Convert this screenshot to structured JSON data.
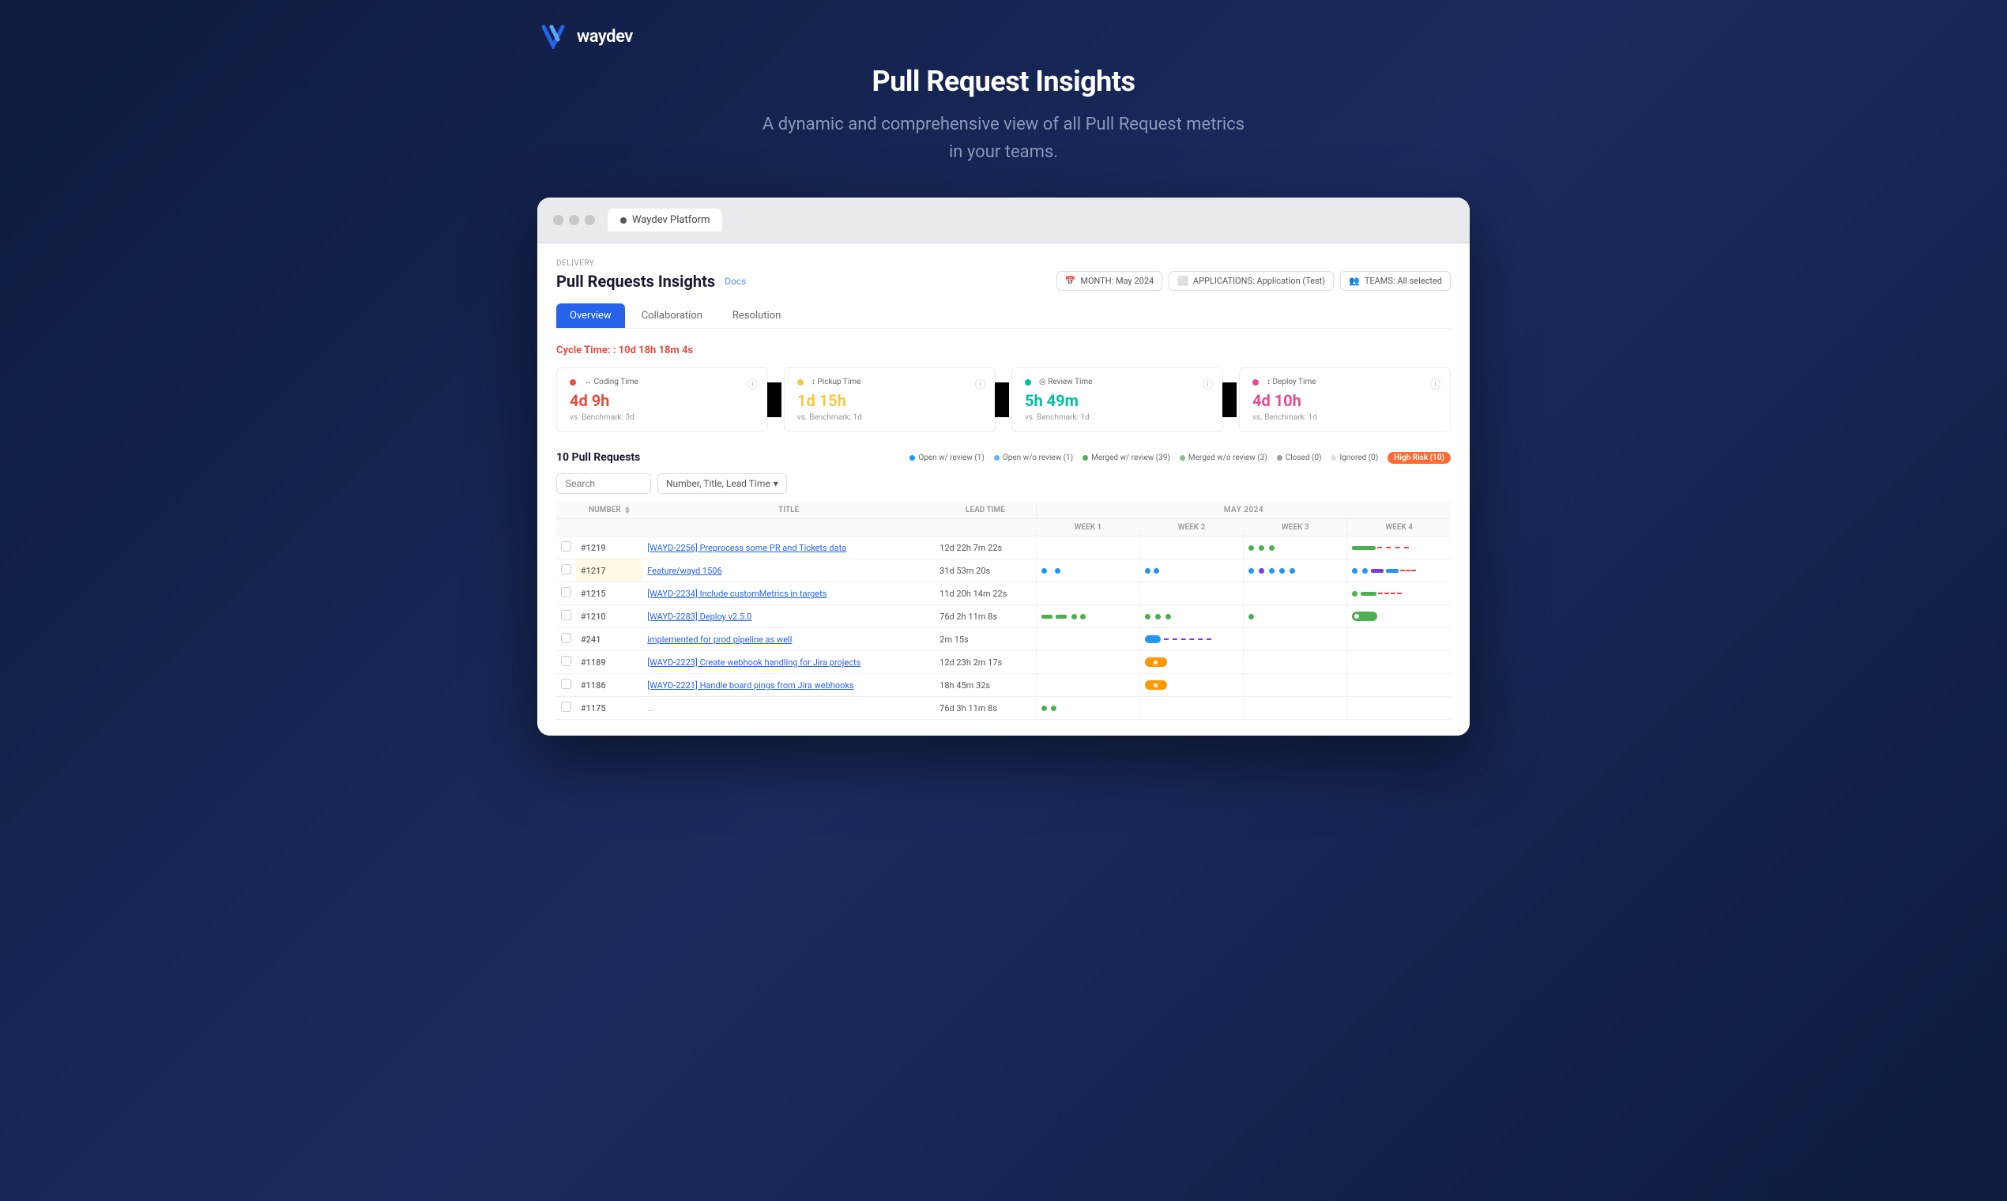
{
  "logo": {
    "text": "waydev"
  },
  "hero": {
    "title": "Pull Request Insights",
    "subtitle": "A dynamic and comprehensive view of all Pull Request metrics\nin your teams."
  },
  "window": {
    "tab_label": "Waydev Platform"
  },
  "page": {
    "delivery_label": "DELIVERY",
    "title": "Pull Requests Insights",
    "docs_link": "Docs"
  },
  "filters": {
    "month": "MONTH: May 2024",
    "applications": "APPLICATIONS: Application (Test)",
    "teams": "TEAMS: All selected"
  },
  "tabs": [
    {
      "label": "Overview",
      "active": true
    },
    {
      "label": "Collaboration",
      "active": false
    },
    {
      "label": "Resolution",
      "active": false
    }
  ],
  "cycle_time": {
    "label": "Cycle Time: :",
    "value": "10d 18h 18m 4s"
  },
  "metrics": [
    {
      "id": "coding",
      "label": "Coding Time",
      "value": "4d 9h",
      "benchmark": "vs. Benchmark: 3d",
      "dot_color": "#e74c3c",
      "value_color": "#e74c3c"
    },
    {
      "id": "pickup",
      "label": "Pickup Time",
      "value": "1d 15h",
      "benchmark": "vs. Benchmark: 1d",
      "dot_color": "#f5c842",
      "value_color": "#f5c842"
    },
    {
      "id": "review",
      "label": "Review Time",
      "value": "5h 49m",
      "benchmark": "vs. Benchmark: 1d",
      "dot_color": "#00bfa5",
      "value_color": "#00bfa5"
    },
    {
      "id": "deploy",
      "label": "Deploy Time",
      "value": "4d 10h",
      "benchmark": "vs. Benchmark: 1d",
      "dot_color": "#e74c8b",
      "value_color": "#e74c8b"
    }
  ],
  "pr_table": {
    "count_label": "10 Pull Requests",
    "search_placeholder": "Search",
    "sort_label": "Number, Title, Lead Time",
    "legend": [
      {
        "label": "Open w/ review (1)",
        "color": "#2196F3"
      },
      {
        "label": "Open w/o review (1)",
        "color": "#64B5F6"
      },
      {
        "label": "Merged w/ review (39)",
        "color": "#4CAF50"
      },
      {
        "label": "Merged w/o review (3)",
        "color": "#81C784"
      },
      {
        "label": "Closed (0)",
        "color": "#9E9E9E"
      },
      {
        "label": "Ignored (0)",
        "color": "#E0E0E0"
      }
    ],
    "high_risk": "High Risk (10)",
    "timeline_header": "MAY 2024",
    "weeks": [
      "WEEK 1",
      "WEEK 2",
      "WEEK 3",
      "WEEK 4"
    ],
    "columns": [
      "NUMBER",
      "TITLE",
      "LEAD TIME"
    ],
    "rows": [
      {
        "number": "#1219",
        "title": "[WAYD-2256] Preprocess some PR and Tickets data",
        "lead_time": "12d 22h 7m 22s"
      },
      {
        "number": "#1217",
        "title": "Feature/wayd 1506",
        "lead_time": "31d 53m 20s"
      },
      {
        "number": "#1215",
        "title": "[WAYD-2234] Include customMetrics in targets",
        "lead_time": "11d 20h 14m 22s"
      },
      {
        "number": "#1210",
        "title": "[WAYD-2283] Deploy v2.5.0",
        "lead_time": "76d 2h 11m 8s"
      },
      {
        "number": "#241",
        "title": "implemented for prod pipeline as well",
        "lead_time": "2m 15s"
      },
      {
        "number": "#1189",
        "title": "[WAYD-2223] Create webhook handling for Jira projects",
        "lead_time": "12d 23h 2m 17s"
      },
      {
        "number": "#1186",
        "title": "[WAYD-2221] Handle board pings from Jira webhooks",
        "lead_time": "18h 45m 32s"
      },
      {
        "number": "#1175",
        "title": "...",
        "lead_time": "76d 3h 11m 8s"
      }
    ]
  }
}
